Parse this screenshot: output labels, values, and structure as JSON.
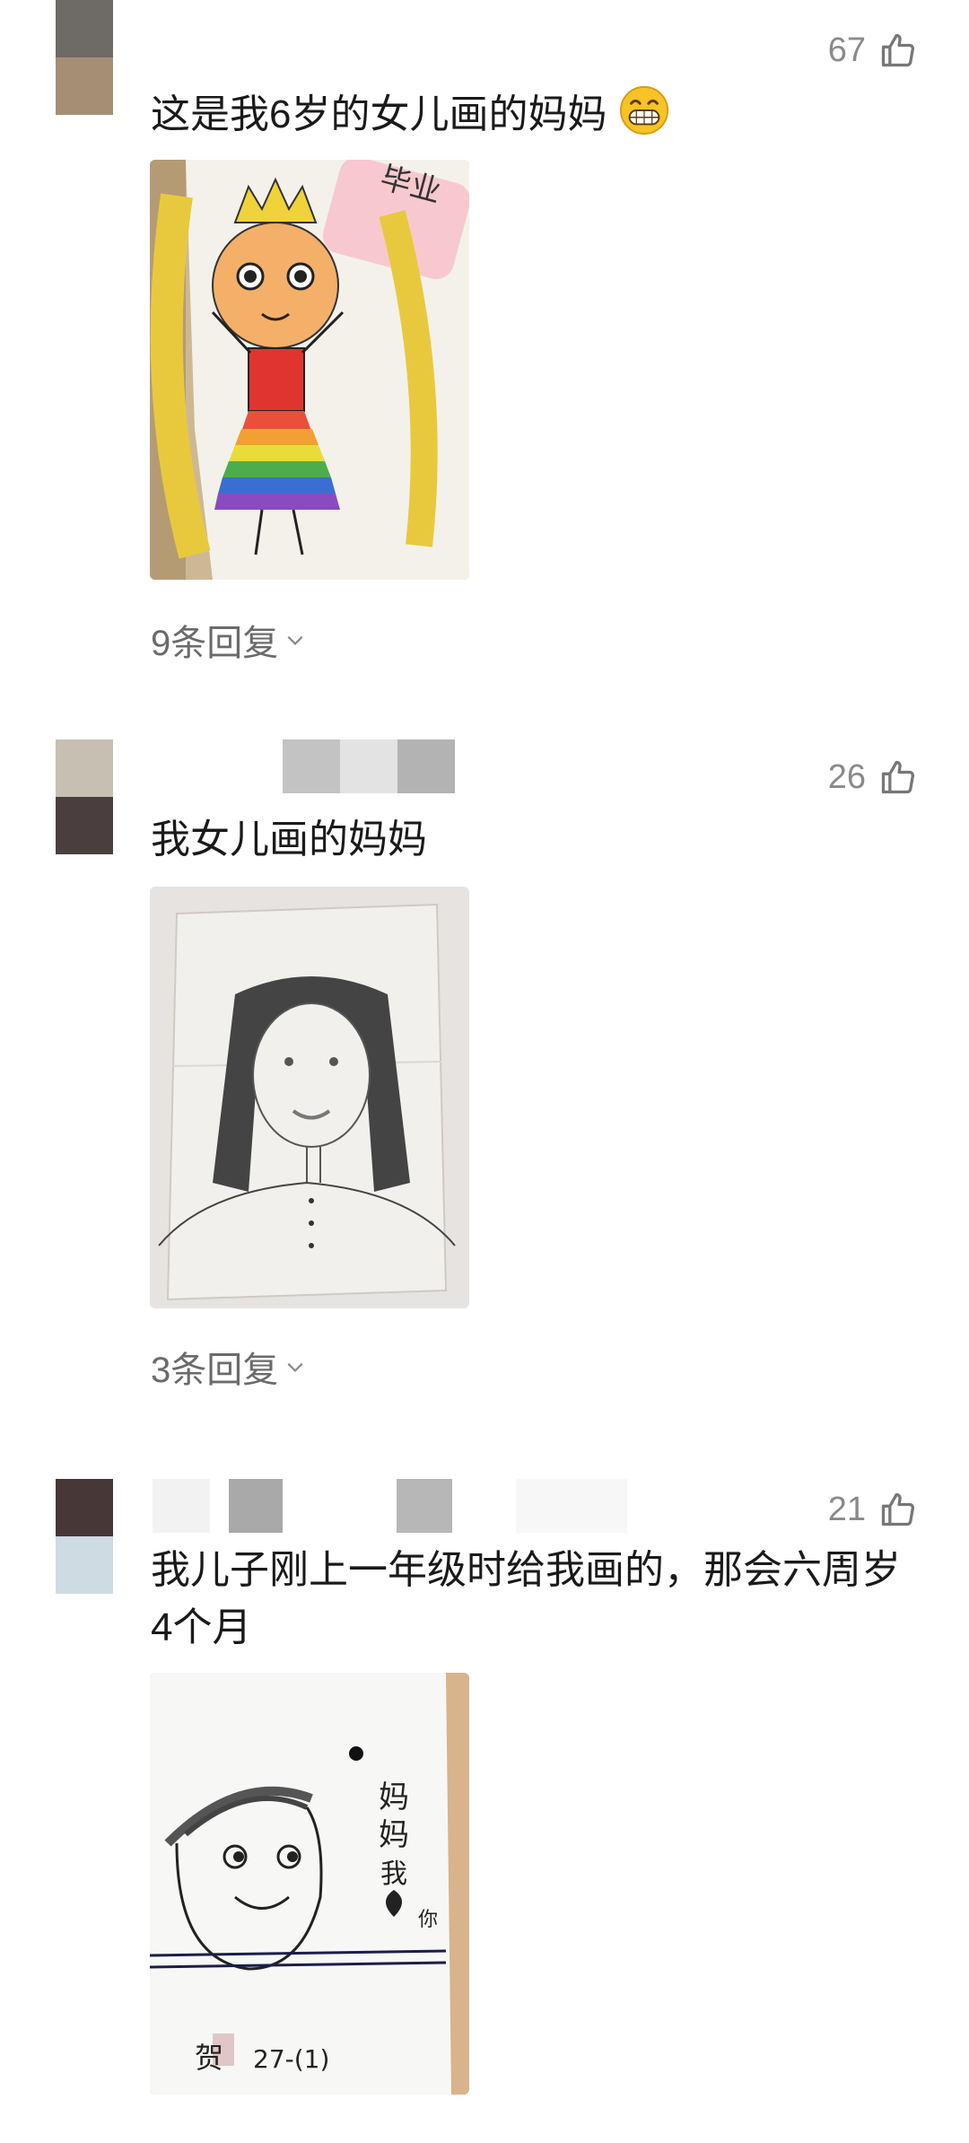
{
  "comments": [
    {
      "likes": "67",
      "text": "这是我6岁的女儿画的妈妈",
      "emoji": "grinning-emoji",
      "replies": "9条回复",
      "photo": "drawing-princess-rainbow-dress",
      "avatar_colors": [
        "#6e6a66",
        "#a48f74"
      ]
    },
    {
      "likes": "26",
      "text": "我女儿画的妈妈",
      "replies": "3条回复",
      "photo": "pencil-portrait-long-hair",
      "avatar_colors": [
        "#c8bfb3",
        "#4a3f3e"
      ]
    },
    {
      "likes": "21",
      "text": "我儿子刚上一年级时给我画的，那会六周岁4个月",
      "photo": "drawing-mom-face-with-heart",
      "photo_caption": "妈妈我❤你",
      "avatar_colors": [
        "#473736",
        "#cfdbe3"
      ]
    }
  ],
  "icons": {
    "like": "thumbs-up-icon",
    "more": "chevron-down-icon"
  }
}
